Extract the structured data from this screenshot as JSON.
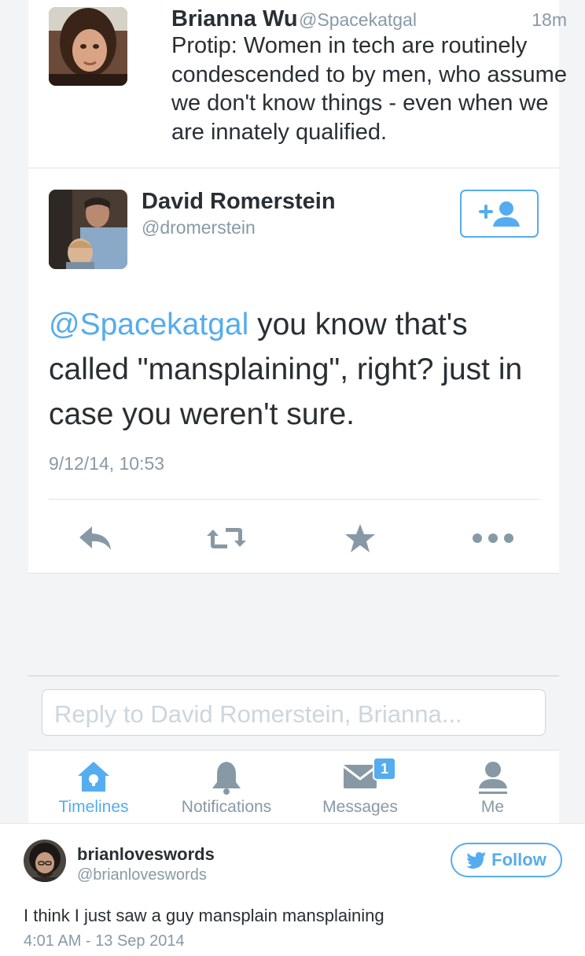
{
  "top_tweet": {
    "name": "Brianna Wu",
    "handle": "@Spacekatgal",
    "time": "18m",
    "text": "Protip: Women in tech are routinely condescended to by men, who assume we don't know things - even when we are innately qualified."
  },
  "main_tweet": {
    "name": "David Romerstein",
    "handle": "@dromerstein",
    "mention": "@Spacekatgal",
    "text": " you know that's called \"mansplaining\", right? just in case you weren't sure.",
    "timestamp": "9/12/14, 10:53",
    "actions": [
      "reply-icon",
      "retweet-icon",
      "favorite-icon",
      "more-icon"
    ]
  },
  "reply": {
    "placeholder": "Reply to David Romerstein, Brianna..."
  },
  "tabs": [
    {
      "label": "Timelines",
      "icon": "home-icon",
      "active": true
    },
    {
      "label": "Notifications",
      "icon": "bell-icon",
      "active": false
    },
    {
      "label": "Messages",
      "icon": "envelope-icon",
      "active": false,
      "badge": "1"
    },
    {
      "label": "Me",
      "icon": "person-icon",
      "active": false
    }
  ],
  "embed": {
    "name": "brianloveswords",
    "handle": "@brianloveswords",
    "follow_label": "Follow",
    "text": "I think I just saw a guy mansplain mansplaining",
    "date": "4:01 AM - 13 Sep 2014"
  },
  "colors": {
    "accent": "#55acee",
    "text": "#292f33",
    "muted": "#8899a6",
    "background": "#f3f4f6"
  }
}
